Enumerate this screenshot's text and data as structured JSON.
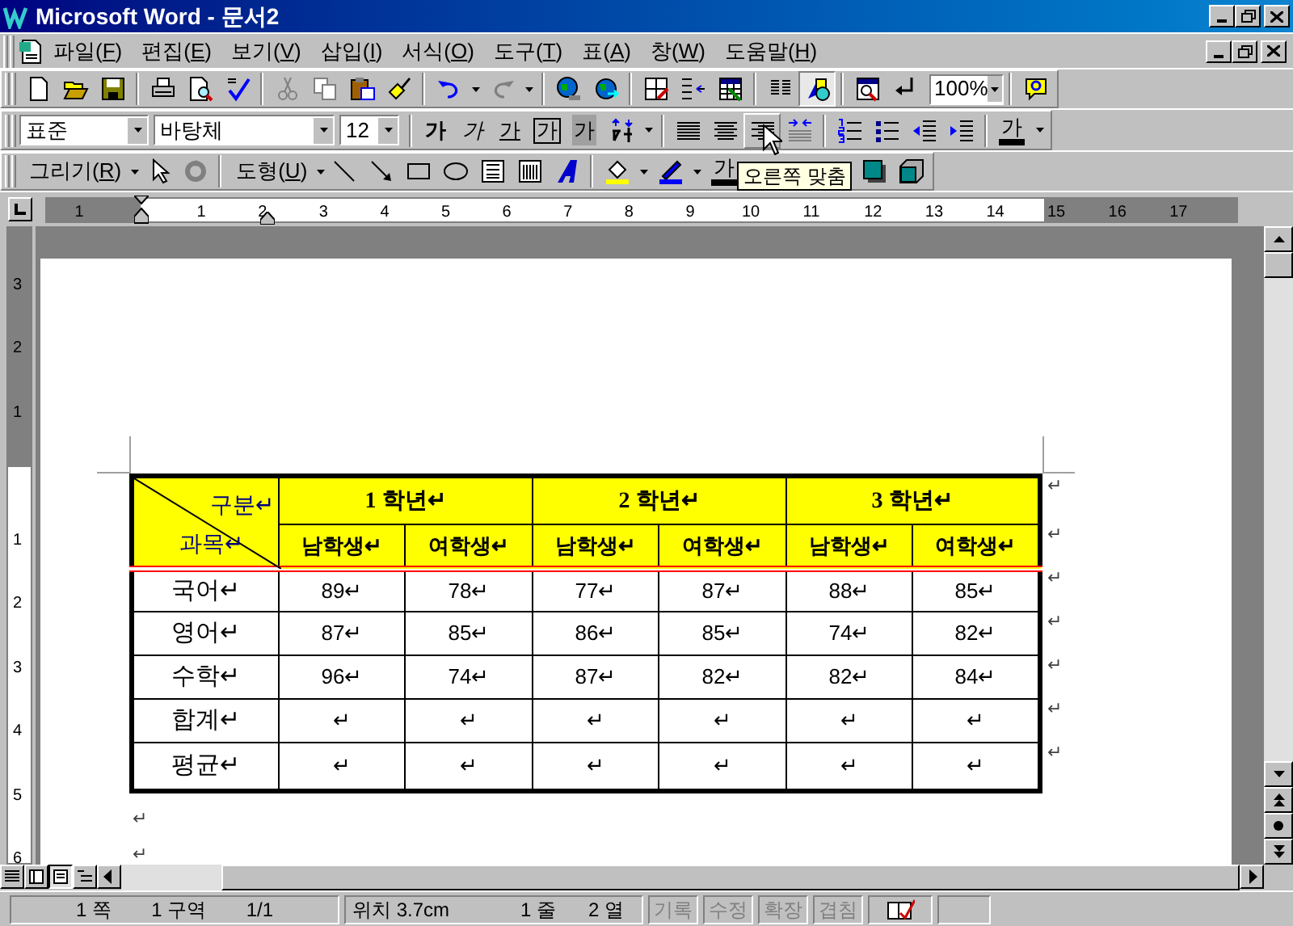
{
  "window": {
    "title": "Microsoft Word - 문서2"
  },
  "menu": [
    {
      "before": "파일(",
      "key": "F",
      "after": ")"
    },
    {
      "before": "편집(",
      "key": "E",
      "after": ")"
    },
    {
      "before": "보기(",
      "key": "V",
      "after": ")"
    },
    {
      "before": "삽입(",
      "key": "I",
      "after": ")"
    },
    {
      "before": "서식(",
      "key": "O",
      "after": ")"
    },
    {
      "before": "도구(",
      "key": "T",
      "after": ")"
    },
    {
      "before": "표(",
      "key": "A",
      "after": ")"
    },
    {
      "before": "창(",
      "key": "W",
      "after": ")"
    },
    {
      "before": "도움말(",
      "key": "H",
      "after": ")"
    }
  ],
  "standard_toolbar": {
    "zoom": "100%",
    "drawing_pressed": true
  },
  "formatting_toolbar": {
    "style": "표준",
    "font": "바탕체",
    "size": "12",
    "char_buttons": [
      {
        "kind": "bold",
        "label": "가"
      },
      {
        "kind": "italic",
        "label": "가"
      },
      {
        "kind": "underline",
        "label": "가"
      },
      {
        "kind": "boxed",
        "label": "가"
      },
      {
        "kind": "shaded",
        "label": "가"
      }
    ],
    "font_color_label": "가"
  },
  "drawing_toolbar": {
    "menus": [
      {
        "before": "그리기(",
        "key": "R",
        "after": ")"
      },
      {
        "before": "도형(",
        "key": "U",
        "after": ")"
      }
    ],
    "font_color_label": "가"
  },
  "tooltip": "오른쪽 맞춤",
  "ruler": {
    "horizontal_before": [
      "1"
    ],
    "horizontal": [
      "1",
      "2",
      "3",
      "4",
      "5",
      "6",
      "7",
      "8",
      "9",
      "10",
      "11",
      "12",
      "13",
      "14",
      "15",
      "16",
      "17"
    ],
    "vertical_before": [
      "3",
      "2",
      "1"
    ],
    "vertical": [
      "1",
      "2",
      "3",
      "4",
      "5",
      "6"
    ]
  },
  "table": {
    "corner": {
      "top": "구분↵",
      "bottom": "과목↵"
    },
    "grades": [
      "1 학년↵",
      "2 학년↵",
      "3 학년↵"
    ],
    "subheads": [
      "남학생↵",
      "여학생↵",
      "남학생↵",
      "여학생↵",
      "남학생↵",
      "여학생↵"
    ],
    "rows": [
      {
        "subject": "국어↵",
        "values": [
          "89↵",
          "78↵",
          "77↵",
          "87↵",
          "88↵",
          "85↵"
        ]
      },
      {
        "subject": "영어↵",
        "values": [
          "87↵",
          "85↵",
          "86↵",
          "85↵",
          "74↵",
          "82↵"
        ]
      },
      {
        "subject": "수학↵",
        "values": [
          "96↵",
          "74↵",
          "87↵",
          "82↵",
          "82↵",
          "84↵"
        ]
      },
      {
        "subject": "합계↵",
        "values": [
          "↵",
          "↵",
          "↵",
          "↵",
          "↵",
          "↵"
        ]
      },
      {
        "subject": "평균↵",
        "values": [
          "↵",
          "↵",
          "↵",
          "↵",
          "↵",
          "↵"
        ]
      }
    ],
    "end_marks": [
      "↵",
      "↵",
      "↵",
      "↵",
      "↵",
      "↵",
      "↵"
    ]
  },
  "after_table_marks": [
    "↵",
    "↵"
  ],
  "status_bar": {
    "page": "1 쪽",
    "section": "1 구역",
    "pages": "1/1",
    "position": "위치 3.7cm",
    "line": "1 줄",
    "column": "2 열",
    "modes": [
      {
        "label": "기록",
        "disabled": true
      },
      {
        "label": "수정",
        "disabled": true
      },
      {
        "label": "확장",
        "disabled": true
      },
      {
        "label": "겹침",
        "disabled": true
      }
    ]
  }
}
